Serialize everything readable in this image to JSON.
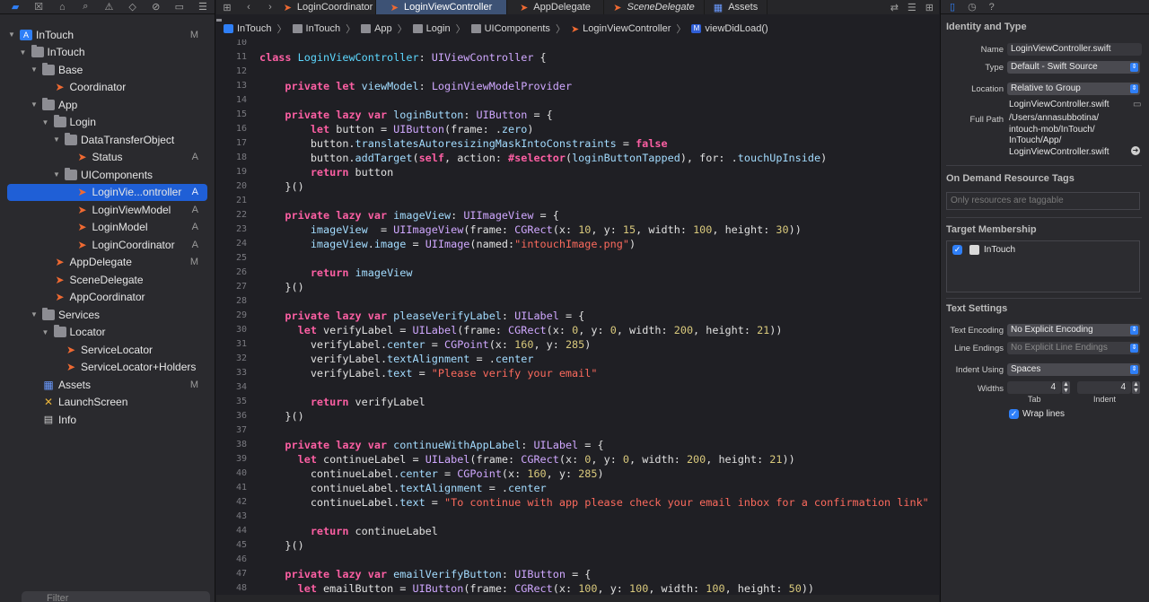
{
  "navigator": {
    "filter_placeholder": "Filter",
    "items": [
      {
        "label": "InTouch",
        "badge": "M",
        "icon": "project-icon",
        "level": 0,
        "open": true
      },
      {
        "label": "InTouch",
        "badge": "",
        "icon": "folder-icon",
        "level": 1,
        "open": true
      },
      {
        "label": "Base",
        "badge": "",
        "icon": "folder-icon",
        "level": 2,
        "open": true
      },
      {
        "label": "Coordinator",
        "badge": "",
        "icon": "swift-file-icon",
        "level": 3
      },
      {
        "label": "App",
        "badge": "",
        "icon": "folder-icon",
        "level": 2,
        "open": true
      },
      {
        "label": "Login",
        "badge": "",
        "icon": "folder-icon",
        "level": 3,
        "open": true
      },
      {
        "label": "DataTransferObject",
        "badge": "",
        "icon": "folder-icon",
        "level": 4,
        "open": true
      },
      {
        "label": "Status",
        "badge": "A",
        "icon": "swift-file-icon",
        "level": 5
      },
      {
        "label": "UIComponents",
        "badge": "",
        "icon": "folder-icon",
        "level": 4,
        "open": true
      },
      {
        "label": "LoginVie...ontroller",
        "badge": "A",
        "icon": "swift-file-icon",
        "level": 5,
        "selected": true
      },
      {
        "label": "LoginViewModel",
        "badge": "A",
        "icon": "swift-file-icon",
        "level": 5
      },
      {
        "label": "LoginModel",
        "badge": "A",
        "icon": "swift-file-icon",
        "level": 5
      },
      {
        "label": "LoginCoordinator",
        "badge": "A",
        "icon": "swift-file-icon",
        "level": 5
      },
      {
        "label": "AppDelegate",
        "badge": "M",
        "icon": "swift-file-icon",
        "level": 3
      },
      {
        "label": "SceneDelegate",
        "badge": "",
        "icon": "swift-file-icon",
        "level": 3
      },
      {
        "label": "AppCoordinator",
        "badge": "",
        "icon": "swift-file-icon",
        "level": 3
      },
      {
        "label": "Services",
        "badge": "",
        "icon": "folder-icon",
        "level": 2,
        "open": true
      },
      {
        "label": "Locator",
        "badge": "",
        "icon": "folder-icon",
        "level": 3,
        "open": true
      },
      {
        "label": "ServiceLocator",
        "badge": "",
        "icon": "swift-file-icon",
        "level": 4
      },
      {
        "label": "ServiceLocator+Holders",
        "badge": "",
        "icon": "swift-file-icon",
        "level": 4
      },
      {
        "label": "Assets",
        "badge": "M",
        "icon": "assets-icon",
        "level": 2
      },
      {
        "label": "LaunchScreen",
        "badge": "",
        "icon": "launchscreen-icon",
        "level": 2
      },
      {
        "label": "Info",
        "badge": "",
        "icon": "info-plist-icon",
        "level": 2
      }
    ]
  },
  "tabs": [
    {
      "label": "LoginCoordinator",
      "icon": "swift-file-icon",
      "active": false,
      "italic": false
    },
    {
      "label": "LoginViewController",
      "icon": "swift-file-icon",
      "active": true,
      "italic": false
    },
    {
      "label": "AppDelegate",
      "icon": "swift-file-icon",
      "active": false,
      "italic": false
    },
    {
      "label": "SceneDelegate",
      "icon": "swift-file-icon",
      "active": false,
      "italic": true
    },
    {
      "label": "Assets",
      "icon": "assets-icon",
      "active": false,
      "italic": false
    }
  ],
  "breadcrumb": [
    "InTouch",
    "InTouch",
    "App",
    "Login",
    "UIComponents",
    "LoginViewController",
    "viewDidLoad()"
  ],
  "code": [
    {
      "n": "10",
      "html": ""
    },
    {
      "n": "11",
      "html": "<span class='k'>class</span> <span class='cls'>LoginViewController</span>: <span class='t'>UIViewController</span> {"
    },
    {
      "n": "12",
      "html": ""
    },
    {
      "n": "13",
      "html": "    <span class='k'>private let</span> <span class='p'>viewModel</span>: <span class='t'>LoginViewModelProvider</span>"
    },
    {
      "n": "14",
      "html": ""
    },
    {
      "n": "15",
      "html": "    <span class='k'>private lazy var</span> <span class='p'>loginButton</span>: <span class='t'>UIButton</span> = {"
    },
    {
      "n": "16",
      "html": "        <span class='k'>let</span> button = <span class='t'>UIButton</span>(frame: .<span class='p'>zero</span>)"
    },
    {
      "n": "17",
      "html": "        button.<span class='p'>translatesAutoresizingMaskIntoConstraints</span> = <span class='k'>false</span>"
    },
    {
      "n": "18",
      "html": "        button.<span class='p'>addTarget</span>(<span class='k'>self</span>, action: <span class='k'>#selector</span>(<span class='p'>loginButtonTapped</span>), for: .<span class='p'>touchUpInside</span>)"
    },
    {
      "n": "19",
      "html": "        <span class='k'>return</span> button"
    },
    {
      "n": "20",
      "html": "    }()"
    },
    {
      "n": "21",
      "html": ""
    },
    {
      "n": "22",
      "html": "    <span class='k'>private lazy var</span> <span class='p'>imageView</span>: <span class='t'>UIImageView</span> = {"
    },
    {
      "n": "23",
      "html": "        <span class='p'>imageView</span>  = <span class='t'>UIImageView</span>(frame: <span class='t'>CGRect</span>(x: <span class='n'>10</span>, y: <span class='n'>15</span>, width: <span class='n'>100</span>, height: <span class='n'>30</span>))"
    },
    {
      "n": "24",
      "html": "        <span class='p'>imageView</span>.<span class='p'>image</span> = <span class='t'>UIImage</span>(named:<span class='s'>\"intouchImage.png\"</span>)"
    },
    {
      "n": "25",
      "html": ""
    },
    {
      "n": "26",
      "html": "        <span class='k'>return</span> <span class='p'>imageView</span>"
    },
    {
      "n": "27",
      "html": "    }()"
    },
    {
      "n": "28",
      "html": ""
    },
    {
      "n": "29",
      "html": "    <span class='k'>private lazy var</span> <span class='p'>pleaseVerifyLabel</span>: <span class='t'>UILabel</span> = {"
    },
    {
      "n": "30",
      "html": "      <span class='k'>let</span> verifyLabel = <span class='t'>UILabel</span>(frame: <span class='t'>CGRect</span>(x: <span class='n'>0</span>, y: <span class='n'>0</span>, width: <span class='n'>200</span>, height: <span class='n'>21</span>))"
    },
    {
      "n": "31",
      "html": "        verifyLabel.<span class='p'>center</span> = <span class='t'>CGPoint</span>(x: <span class='n'>160</span>, y: <span class='n'>285</span>)"
    },
    {
      "n": "32",
      "html": "        verifyLabel.<span class='p'>textAlignment</span> = .<span class='p'>center</span>"
    },
    {
      "n": "33",
      "html": "        verifyLabel.<span class='p'>text</span> = <span class='s'>\"Please verify your email\"</span>"
    },
    {
      "n": "34",
      "html": ""
    },
    {
      "n": "35",
      "html": "        <span class='k'>return</span> verifyLabel"
    },
    {
      "n": "36",
      "html": "    }()"
    },
    {
      "n": "37",
      "html": ""
    },
    {
      "n": "38",
      "html": "    <span class='k'>private lazy var</span> <span class='p'>continueWithAppLabel</span>: <span class='t'>UILabel</span> = {"
    },
    {
      "n": "39",
      "html": "      <span class='k'>let</span> continueLabel = <span class='t'>UILabel</span>(frame: <span class='t'>CGRect</span>(x: <span class='n'>0</span>, y: <span class='n'>0</span>, width: <span class='n'>200</span>, height: <span class='n'>21</span>))"
    },
    {
      "n": "40",
      "html": "        continueLabel.<span class='p'>center</span> = <span class='t'>CGPoint</span>(x: <span class='n'>160</span>, y: <span class='n'>285</span>)"
    },
    {
      "n": "41",
      "html": "        continueLabel.<span class='p'>textAlignment</span> = .<span class='p'>center</span>"
    },
    {
      "n": "42",
      "html": "        continueLabel.<span class='p'>text</span> = <span class='s'>\"To continue with app please check your email inbox for a confirmation link\"</span>"
    },
    {
      "n": "43",
      "html": ""
    },
    {
      "n": "44",
      "html": "        <span class='k'>return</span> continueLabel"
    },
    {
      "n": "45",
      "html": "    }()"
    },
    {
      "n": "46",
      "html": ""
    },
    {
      "n": "47",
      "html": "    <span class='k'>private lazy var</span> <span class='p'>emailVerifyButton</span>: <span class='t'>UIButton</span> = {"
    },
    {
      "n": "48",
      "html": "      <span class='k'>let</span> emailButton = <span class='t'>UIButton</span>(frame: <span class='t'>CGRect</span>(x: <span class='n'>100</span>, y: <span class='n'>100</span>, width: <span class='n'>100</span>, height: <span class='n'>50</span>))"
    }
  ],
  "inspector": {
    "identity": {
      "title": "Identity and Type",
      "name_label": "Name",
      "name_value": "LoginViewController.swift",
      "type_label": "Type",
      "type_value": "Default - Swift Source",
      "location_label": "Location",
      "location_value": "Relative to Group",
      "location_file": "LoginViewController.swift",
      "full_path_label": "Full Path",
      "full_path_lines": [
        "/Users/annasubbotina/",
        "intouch-mob/InTouch/",
        "InTouch/App/",
        "LoginViewController.swift"
      ]
    },
    "on_demand": {
      "title": "On Demand Resource Tags",
      "placeholder": "Only resources are taggable"
    },
    "target_membership": {
      "title": "Target Membership",
      "target": "InTouch",
      "checked": true
    },
    "text_settings": {
      "title": "Text Settings",
      "encoding_label": "Text Encoding",
      "encoding_value": "No Explicit Encoding",
      "line_endings_label": "Line Endings",
      "line_endings_value": "No Explicit Line Endings",
      "indent_using_label": "Indent Using",
      "indent_using_value": "Spaces",
      "widths_label": "Widths",
      "tab_value": "4",
      "tab_label": "Tab",
      "indent_value": "4",
      "indent_label": "Indent",
      "wrap_lines_label": "Wrap lines",
      "wrap_lines": true
    }
  },
  "colors": {
    "accent": "#2f7ff7",
    "selection": "#1f5fd6",
    "swift_orange": "#f06a32"
  }
}
